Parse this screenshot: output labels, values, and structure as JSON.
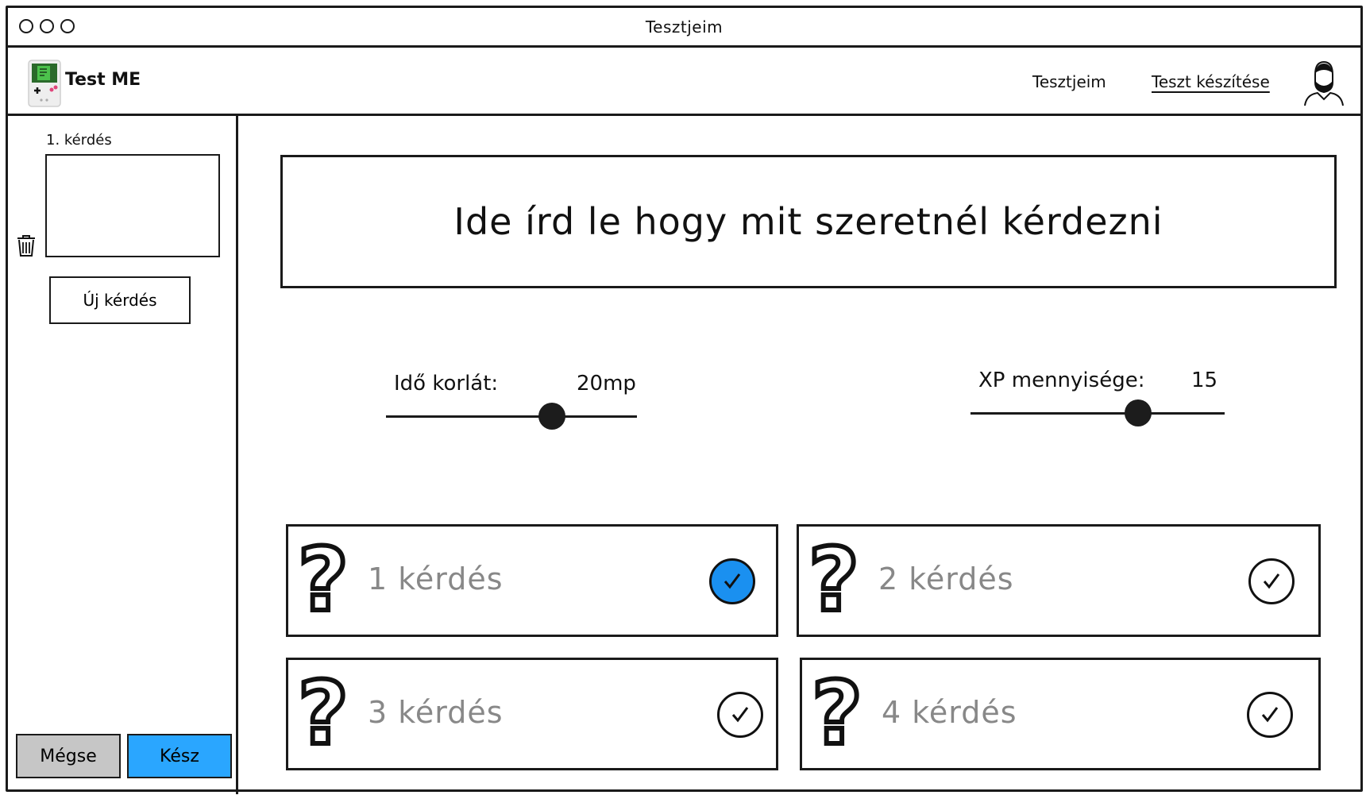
{
  "window": {
    "title": "Tesztjeim"
  },
  "header": {
    "brand": "Test ME",
    "nav": [
      {
        "label": "Tesztjeim",
        "active": false
      },
      {
        "label": "Teszt készítése",
        "active": true
      }
    ]
  },
  "sidebar": {
    "question_label": "1. kérdés",
    "new_question_button": "Új kérdés",
    "cancel_button": "Mégse",
    "done_button": "Kész"
  },
  "editor": {
    "question_placeholder": "Ide írd le hogy mit szeretnél kérdezni",
    "time_limit": {
      "label": "Idő korlát:",
      "value": "20mp",
      "fraction": 0.66
    },
    "xp": {
      "label": "XP mennyisége:",
      "value": "15",
      "fraction": 0.66
    }
  },
  "answers": [
    {
      "label": "1 kérdés",
      "selected": true
    },
    {
      "label": "2 kérdés",
      "selected": false
    },
    {
      "label": "3 kérdés",
      "selected": false
    },
    {
      "label": "4 kérdés",
      "selected": false
    }
  ],
  "colors": {
    "accent": "#1a90f0",
    "done_button": "#2aa6ff",
    "cancel_button": "#c6c6c6",
    "answer_text": "#888888"
  },
  "icons": {
    "trash": "trash-icon",
    "question": "question-mark-icon",
    "check": "check-circle-icon",
    "avatar": "user-avatar-icon"
  }
}
